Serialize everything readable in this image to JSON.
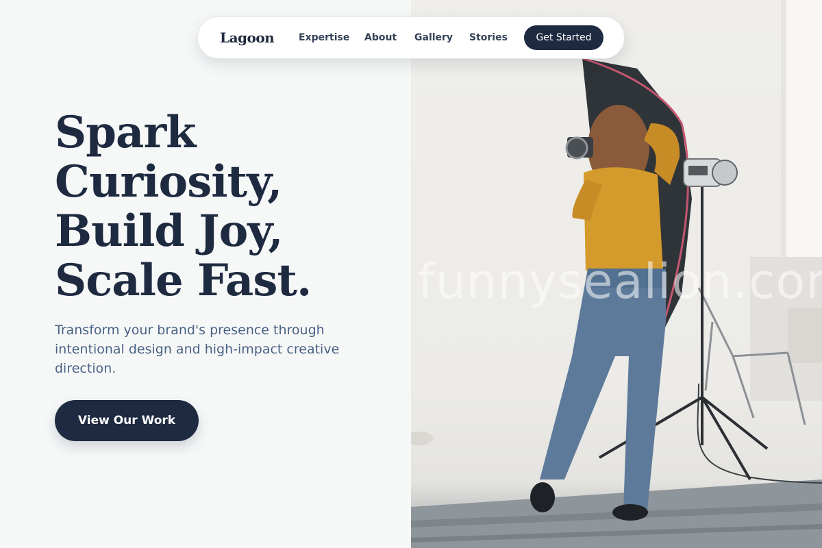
{
  "nav": {
    "brand": "Lagoon",
    "links": [
      "Expertise",
      "About",
      "Gallery",
      "Stories"
    ],
    "cta_label": "Get Started"
  },
  "hero": {
    "headline_lines": [
      "Spark",
      "Curiosity,",
      "Build Joy,",
      "Scale Fast."
    ],
    "subtitle": "Transform your brand's presence through intentional design and high-impact creative direction.",
    "cta_label": "View Our Work"
  },
  "image": {
    "watermark": "funnysealion.com"
  },
  "colors": {
    "navy": "#1e2a40",
    "subtitle": "#4a6284",
    "left_background": "#f6f8f8"
  }
}
